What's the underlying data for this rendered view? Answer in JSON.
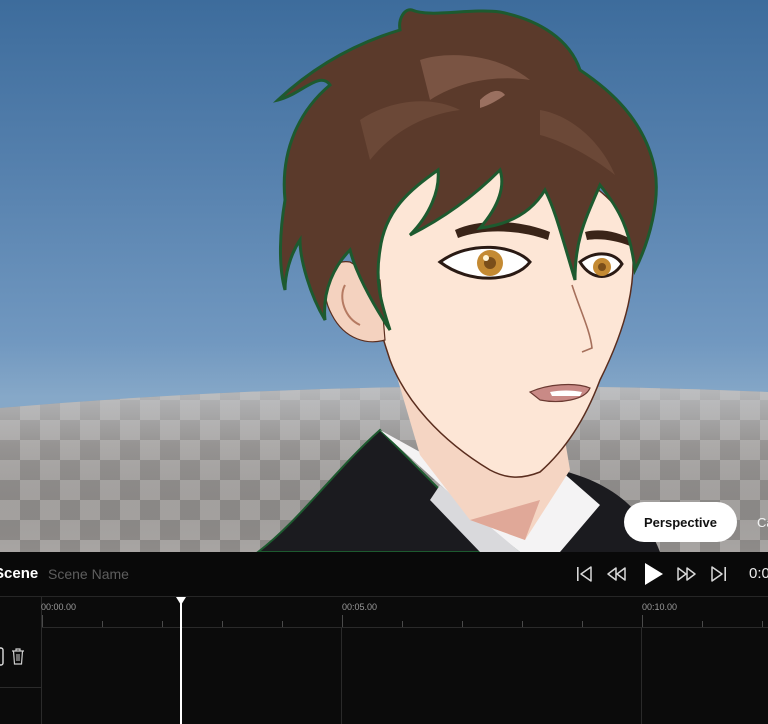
{
  "viewport": {
    "view_modes": [
      "Perspective",
      "Ca"
    ],
    "active_view": "Perspective"
  },
  "transport": {
    "scene_label": "Scene",
    "scene_name_placeholder": "Scene Name",
    "time": "0:0",
    "buttons": [
      "skip-to-start",
      "rewind",
      "play",
      "fast-forward",
      "skip-to-end"
    ]
  },
  "timeline": {
    "tick_labels": [
      "00:00.00",
      "00:05.00",
      "00:10.00"
    ],
    "playhead_icon": "delete-track-icon"
  },
  "colors": {
    "background": "#0a0a0a",
    "accent": "#ffffff",
    "sky": "#5a84b0"
  }
}
